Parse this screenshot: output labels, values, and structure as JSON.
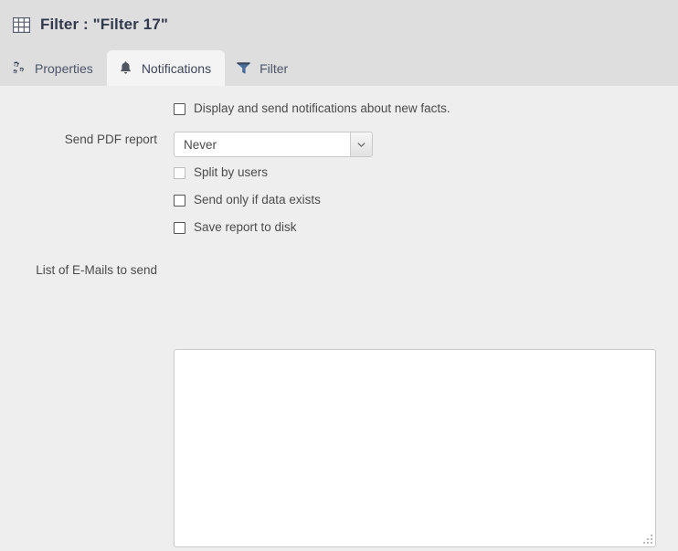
{
  "window": {
    "icon": "table-grid-icon",
    "title": "Filter : \"Filter 17\""
  },
  "tabs": [
    {
      "id": "properties",
      "label": "Properties",
      "icon": "cogs-icon",
      "active": false
    },
    {
      "id": "notifications",
      "label": "Notifications",
      "icon": "bell-icon",
      "active": true
    },
    {
      "id": "filter",
      "label": "Filter",
      "icon": "funnel-icon",
      "active": false
    }
  ],
  "form": {
    "notify_checkbox": {
      "label": "Display and send notifications about new facts.",
      "checked": false,
      "disabled": false
    },
    "send_pdf_report": {
      "label": "Send PDF report",
      "value": "Never",
      "options": [
        "Never"
      ]
    },
    "options": [
      {
        "id": "split-by-users",
        "label": "Split by users",
        "checked": false,
        "disabled": true
      },
      {
        "id": "send-only-if-data",
        "label": "Send only if data exists",
        "checked": false,
        "disabled": false
      },
      {
        "id": "save-report-to-disk",
        "label": "Save report to disk",
        "checked": false,
        "disabled": false
      }
    ],
    "emails": {
      "label": "List of E-Mails to send",
      "value": "",
      "placeholder": ""
    }
  },
  "colors": {
    "header_bg": "#dedede",
    "content_bg": "#eeeeee",
    "active_tab_bg": "#f4f4f4",
    "title_text": "#333a4d",
    "body_text": "#4b4b4b",
    "funnel_blue": "#4a6d9e",
    "field_border": "#c9c9c9"
  }
}
